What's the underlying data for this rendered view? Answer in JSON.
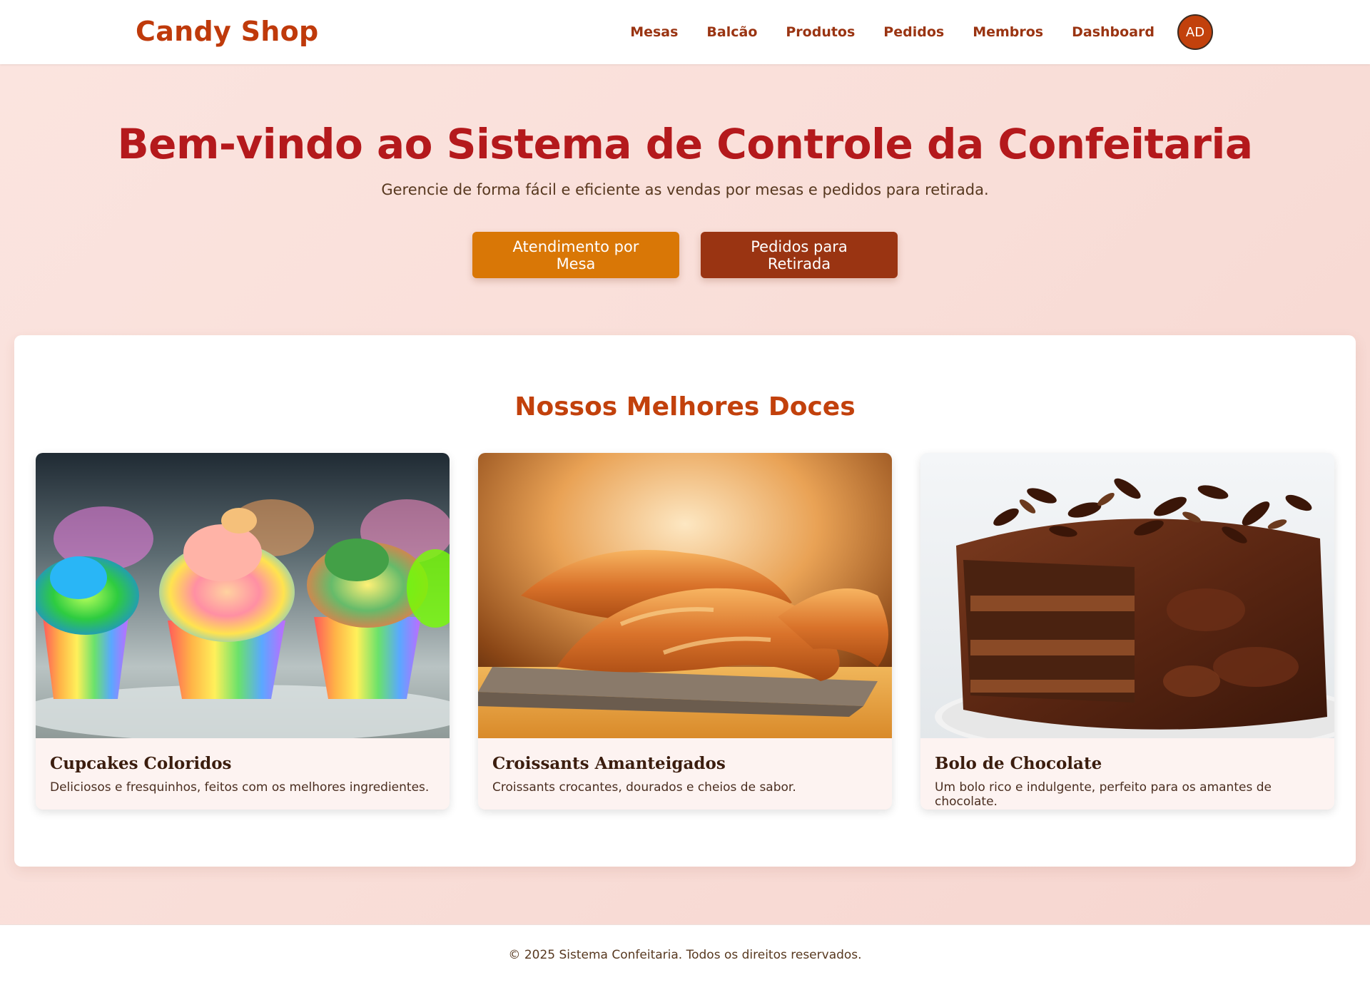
{
  "header": {
    "brand": "Candy Shop",
    "nav": [
      "Mesas",
      "Balcão",
      "Produtos",
      "Pedidos",
      "Membros",
      "Dashboard"
    ],
    "avatar_initials": "AD"
  },
  "hero": {
    "title": "Bem-vindo ao Sistema de Controle da Confeitaria",
    "subtitle": "Gerencie de forma fácil e eficiente as vendas por mesas e pedidos para retirada.",
    "buttons": {
      "mesa": "Atendimento por Mesa",
      "retirada": "Pedidos para Retirada"
    }
  },
  "products": {
    "title": "Nossos Melhores Doces",
    "items": [
      {
        "title": "Cupcakes Coloridos",
        "description": "Deliciosos e fresquinhos, feitos com os melhores ingredientes."
      },
      {
        "title": "Croissants Amanteigados",
        "description": "Croissants crocantes, dourados e cheios de sabor."
      },
      {
        "title": "Bolo de Chocolate",
        "description": "Um bolo rico e indulgente, perfeito para os amantes de chocolate."
      }
    ]
  },
  "footer": {
    "text": "© 2025 Sistema Confeitaria. Todos os direitos reservados."
  },
  "colors": {
    "brand": "#bf3a0b",
    "nav_link": "#9a3412",
    "hero_title": "#b4191c",
    "button_mesa": "#d97706",
    "button_retirada": "#9a3412",
    "section_title": "#c2410c"
  }
}
